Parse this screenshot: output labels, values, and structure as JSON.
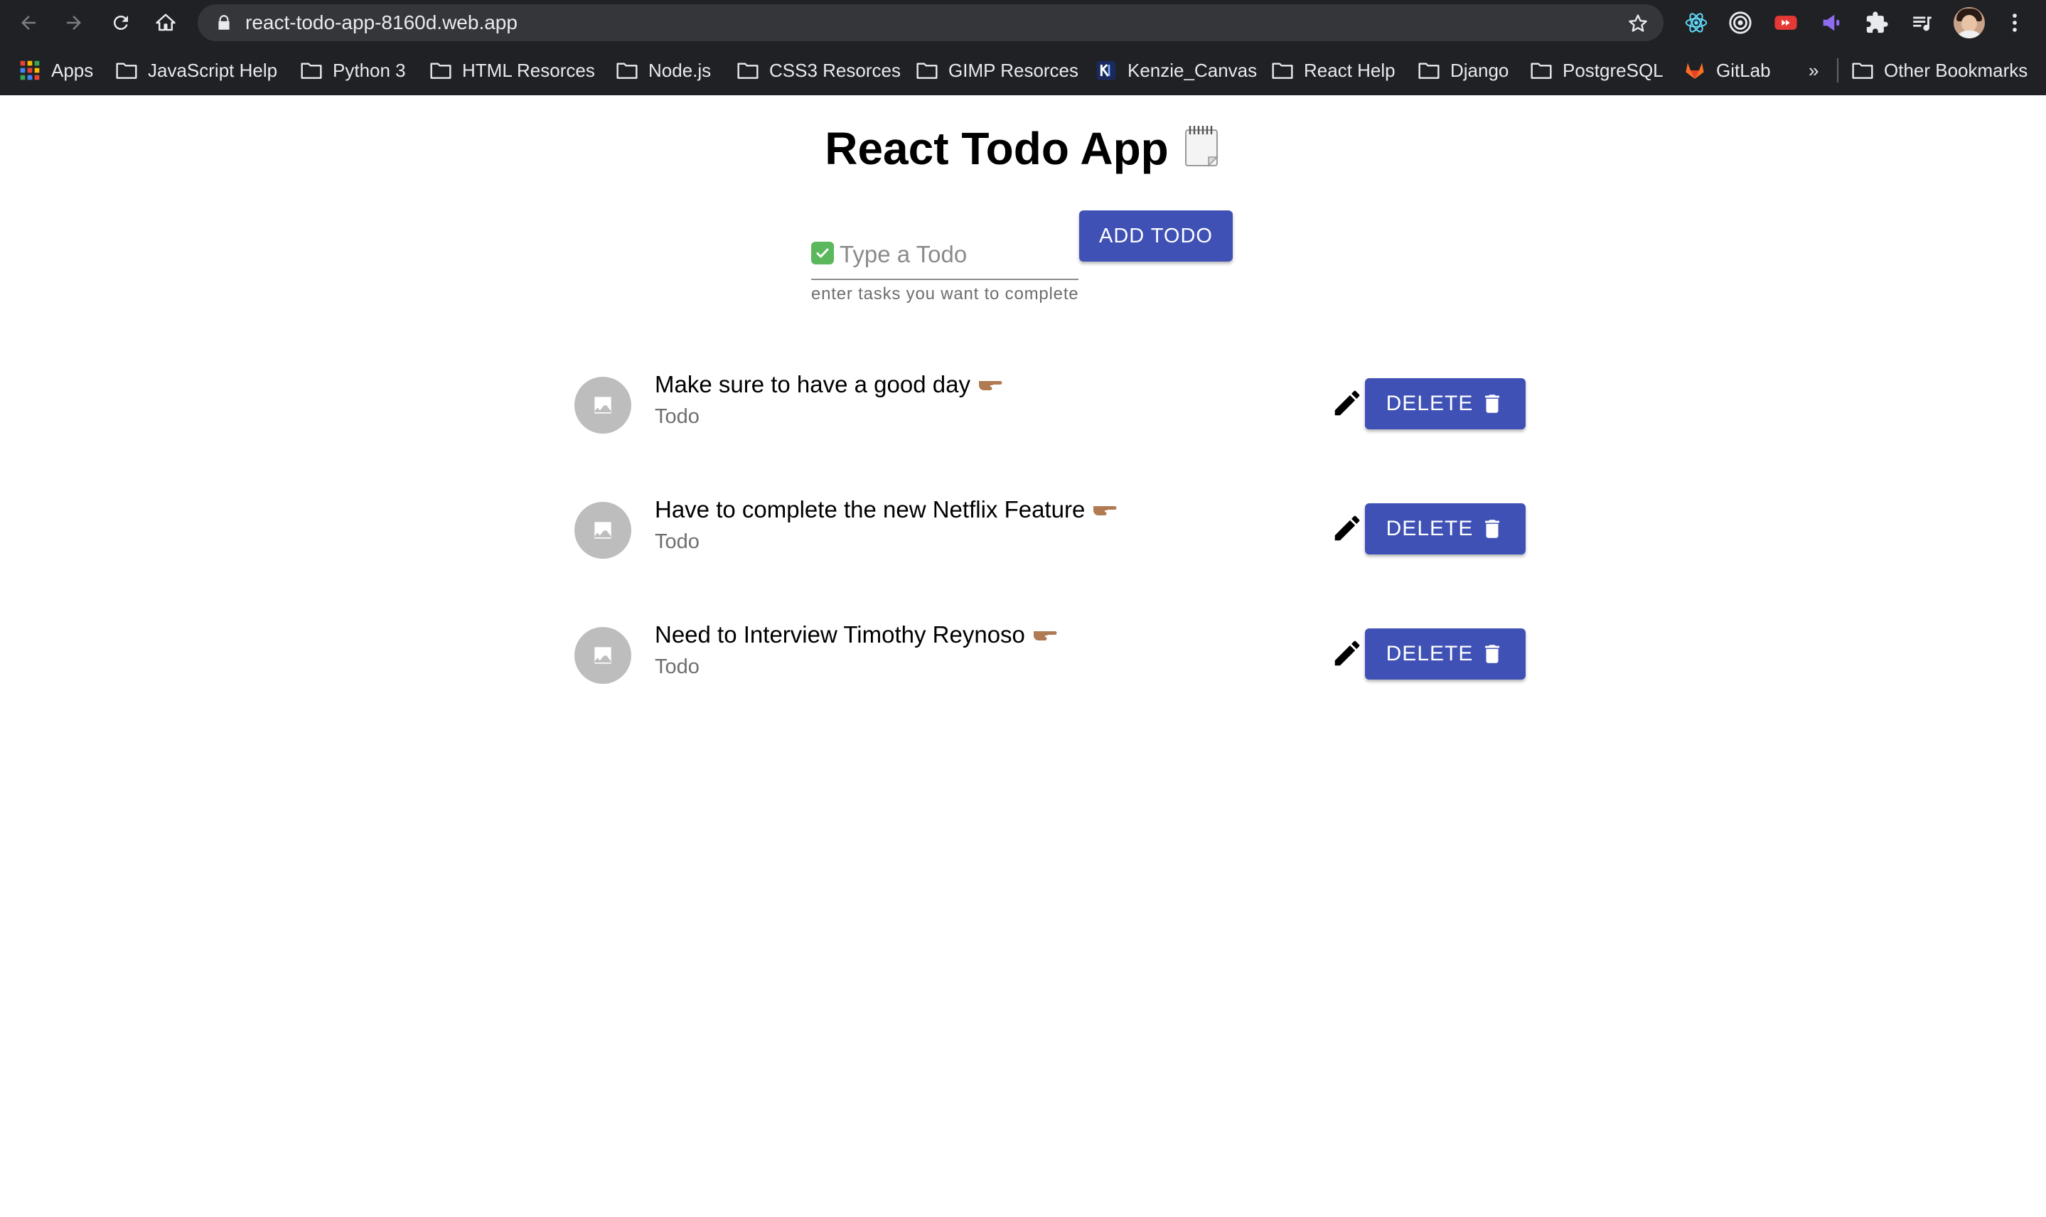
{
  "browser": {
    "url": "react-todo-app-8160d.web.app",
    "bookmarks": [
      {
        "label": "Apps",
        "icon": "apps-grid-icon"
      },
      {
        "label": "JavaScript Help",
        "icon": "folder-icon"
      },
      {
        "label": "Python 3",
        "icon": "folder-icon"
      },
      {
        "label": "HTML Resorces",
        "icon": "folder-icon"
      },
      {
        "label": "Node.js",
        "icon": "folder-icon"
      },
      {
        "label": "CSS3 Resorces",
        "icon": "folder-icon"
      },
      {
        "label": "GIMP Resorces",
        "icon": "folder-icon"
      },
      {
        "label": "Kenzie_Canvas",
        "icon": "kenzie-icon"
      },
      {
        "label": "React Help",
        "icon": "folder-icon"
      },
      {
        "label": "Django",
        "icon": "folder-icon"
      },
      {
        "label": "PostgreSQL",
        "icon": "folder-icon"
      },
      {
        "label": "GitLab",
        "icon": "gitlab-icon"
      }
    ],
    "overflow_label": "»",
    "other_bookmarks": "Other Bookmarks"
  },
  "app": {
    "title": "React Todo App",
    "input_placeholder": "Type a Todo",
    "input_value": "",
    "helper_text": "enter tasks you want to complete",
    "add_button_label": "ADD TODO",
    "delete_button_label": "DELETE",
    "todos": [
      {
        "text": "Make sure to have a good day",
        "secondary": "Todo"
      },
      {
        "text": "Have to complete the new Netflix Feature",
        "secondary": "Todo"
      },
      {
        "text": "Need to Interview Timothy Reynoso",
        "secondary": "Todo"
      }
    ]
  },
  "colors": {
    "primary": "#3f51b5",
    "chrome_bg": "#202124",
    "omnibox_bg": "#35363a",
    "avatar_bg": "#bdbdbd"
  }
}
